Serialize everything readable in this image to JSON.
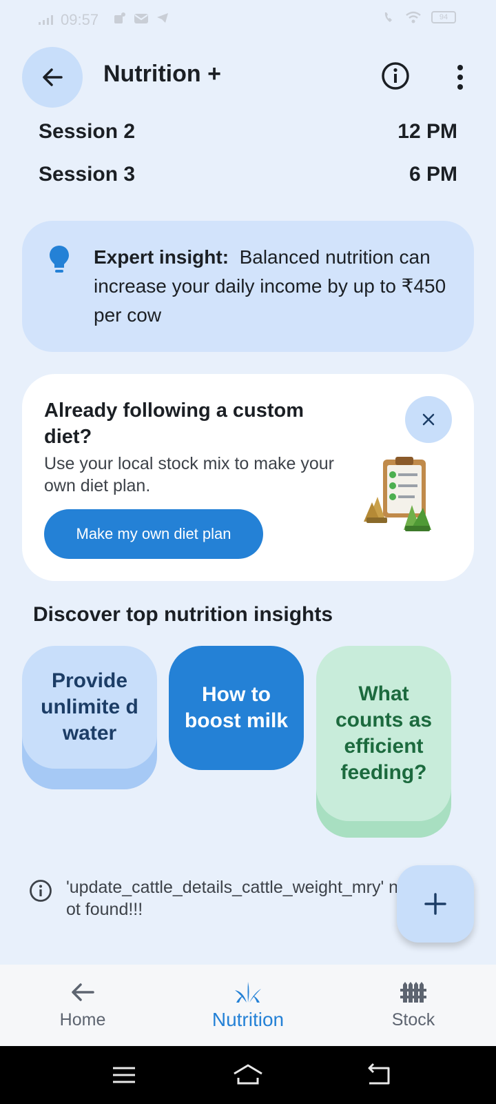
{
  "status_bar": {
    "time": "09:57",
    "battery": "94",
    "icons": [
      "signal-icon",
      "teams-icon",
      "mail-icon",
      "telegram-icon",
      "call-icon",
      "wifi-icon",
      "battery-icon"
    ]
  },
  "app_bar": {
    "title": "Nutrition +",
    "back_icon": "arrow-left-icon",
    "info_icon": "info-icon",
    "more_icon": "more-vertical-icon"
  },
  "sessions": [
    {
      "label": "Session 2",
      "time": "12 PM"
    },
    {
      "label": "Session 3",
      "time": "6 PM"
    }
  ],
  "expert_insight": {
    "icon": "lightbulb-icon",
    "label": "Expert insight:",
    "text": "Balanced nutrition can increase your daily income by up to ₹450 per cow"
  },
  "custom_diet_card": {
    "title": "Already following a custom diet?",
    "description": "Use your local stock mix to make your own diet plan.",
    "button_label": "Make my own diet plan",
    "close_icon": "close-icon",
    "illustration": "diet-plan-clipboard-illustration"
  },
  "discover": {
    "title": "Discover top nutrition insights",
    "tiles": [
      {
        "label": "Provide unlimite d water"
      },
      {
        "label": "How to boost milk"
      },
      {
        "label": "What counts as efficient feeding?"
      }
    ]
  },
  "notice": {
    "icon": "info-icon",
    "text": "'update_cattle_details_cattle_weight_mry' not found!!!"
  },
  "fab": {
    "icon": "plus-icon"
  },
  "bottom_nav": {
    "items": [
      {
        "label": "Home",
        "icon": "arrow-left-icon"
      },
      {
        "label": "Nutrition",
        "icon": "grass-icon",
        "active": true
      },
      {
        "label": "Stock",
        "icon": "fence-icon"
      }
    ]
  },
  "colors": {
    "background": "#e8f0fb",
    "accent": "#2481d6",
    "light_blue": "#c8defa",
    "green_tile": "#c8ecda"
  }
}
